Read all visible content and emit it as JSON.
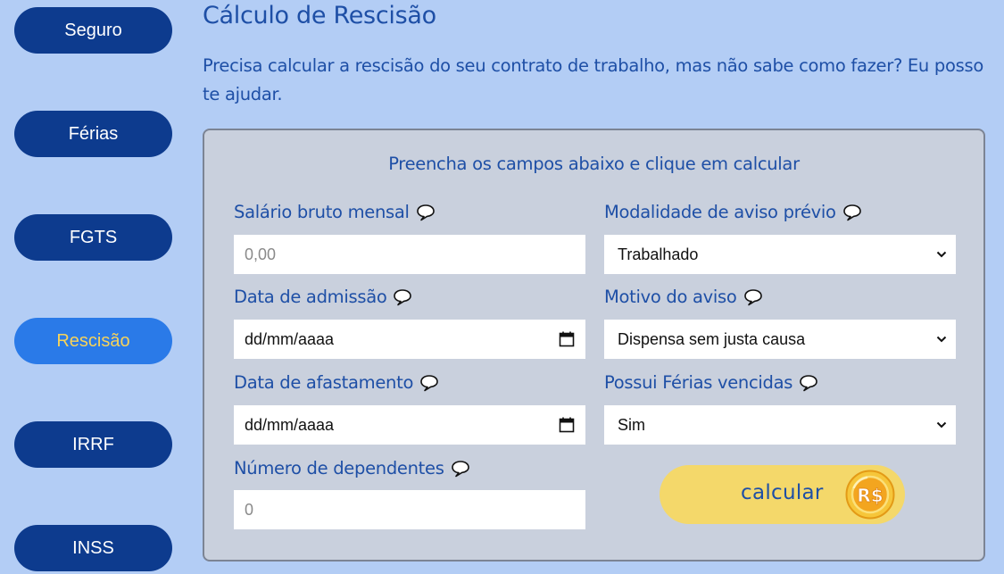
{
  "sidebar": {
    "items": [
      {
        "label": "Seguro",
        "active": false
      },
      {
        "label": "Férias",
        "active": false
      },
      {
        "label": "FGTS",
        "active": false
      },
      {
        "label": "Rescisão",
        "active": true
      },
      {
        "label": "IRRF",
        "active": false
      },
      {
        "label": "INSS",
        "active": false
      }
    ]
  },
  "main": {
    "title": "Cálculo de Rescisão",
    "intro": "Precisa calcular a rescisão do seu contrato de trabalho, mas não sabe como fazer? Eu posso te ajudar."
  },
  "form": {
    "heading": "Preencha os campos abaixo e clique em calcular",
    "salario": {
      "label": "Salário bruto mensal",
      "placeholder": "0,00"
    },
    "admissao": {
      "label": "Data de admissão",
      "value": "dd/mm/aaaa"
    },
    "afastamento": {
      "label": "Data de afastamento",
      "value": "dd/mm/aaaa"
    },
    "dependentes": {
      "label": "Número de dependentes",
      "placeholder": "0"
    },
    "aviso_modalidade": {
      "label": "Modalidade de aviso prévio",
      "selected": "Trabalhado"
    },
    "aviso_motivo": {
      "label": "Motivo do aviso",
      "selected": "Dispensa sem justa causa"
    },
    "ferias_vencidas": {
      "label": "Possui Férias vencidas",
      "selected": "Sim"
    },
    "calc_button": "calcular",
    "coin_text": "R$"
  },
  "colors": {
    "background": "#b3cdf5",
    "nav": "#0d3b8e",
    "nav_active": "#2a7ae8",
    "nav_active_text": "#f7d35a",
    "heading_text": "#1e4fa6",
    "panel": "#c9d0dd",
    "button": "#f4d86a"
  },
  "icons": {
    "help": "speech-bubble-icon",
    "calendar": "calendar-icon",
    "dropdown": "chevron-down-icon",
    "coin": "coin-icon"
  }
}
